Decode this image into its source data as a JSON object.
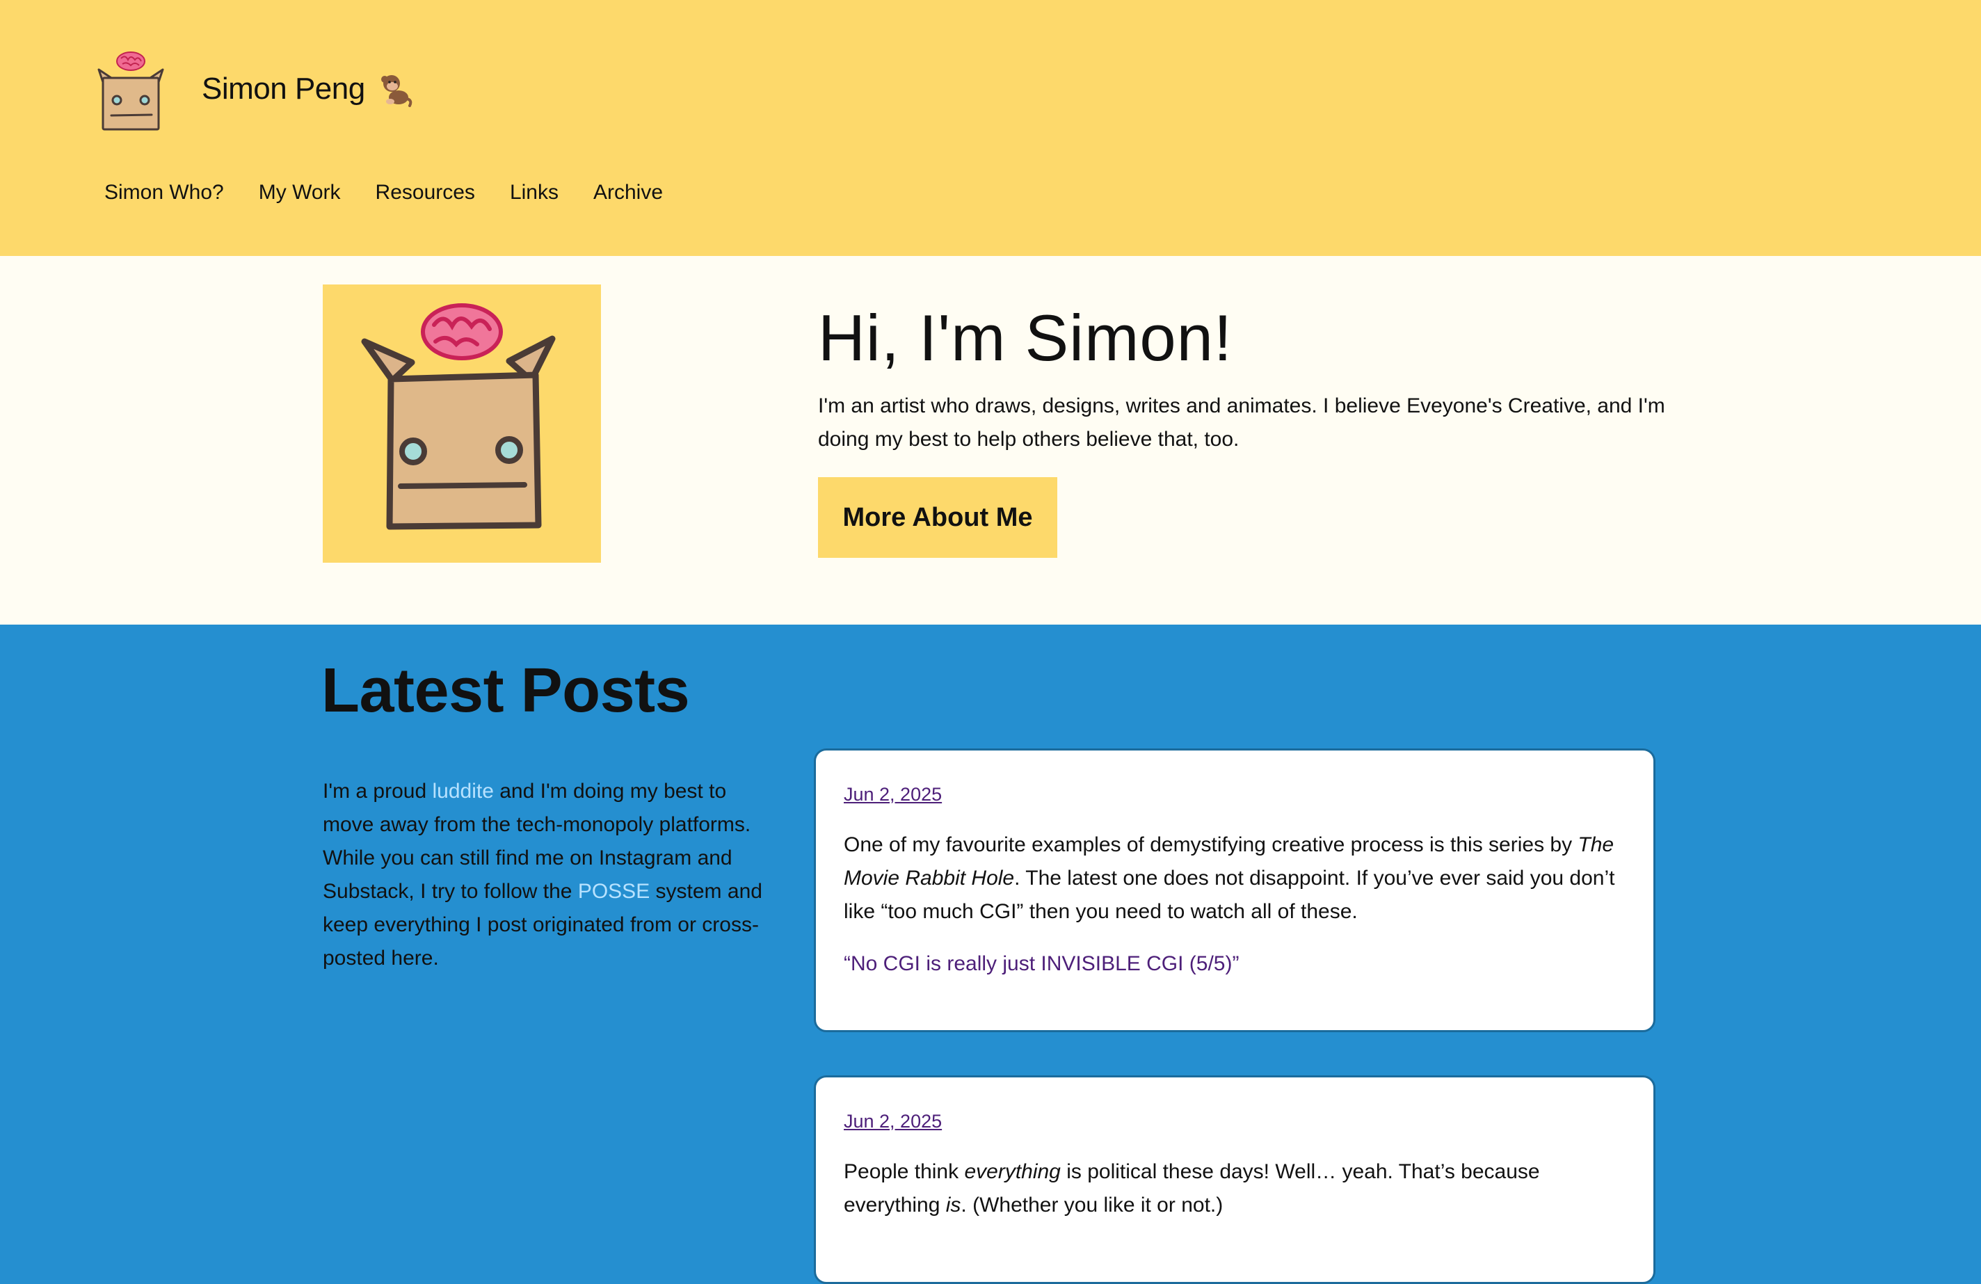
{
  "header": {
    "site_name": "Simon Peng",
    "site_emoji": "monkey-emoji-icon",
    "nav": [
      "Simon Who?",
      "My Work",
      "Resources",
      "Links",
      "Archive"
    ]
  },
  "hero": {
    "title": "Hi, I'm Simon!",
    "text": "I'm an artist who draws, designs, writes and animates. I believe Eveyone's Creative, and I'm doing my best to help others believe that, too.",
    "button": "More About Me"
  },
  "latest": {
    "heading": "Latest Posts",
    "intro_1": "I'm a proud ",
    "intro_link_1": "luddite",
    "intro_2": " and I'm doing my best to move away from the tech-monopoly platforms. While you can still find me on Instagram and Substack, I try to follow the ",
    "intro_link_2": "POSSE",
    "intro_3": " system and keep everything I post originated from or cross-posted here."
  },
  "posts": [
    {
      "date": "Jun 2, 2025",
      "body_1": "One of my favourite examples of demystifying creative process is this series by ",
      "body_em": "The Movie Rabbit Hole",
      "body_2": ". The latest one does not disappoint. If you’ve ever said you don’t like “too much CGI” then you need to watch all of these.",
      "link": "“No CGI is really just INVISIBLE CGI (5/5)”"
    },
    {
      "date": "Jun 2, 2025",
      "body_1": "People think ",
      "body_em": "everything",
      "body_2": " is political these days! Well… yeah. That’s because everything ",
      "body_em_2": "is",
      "body_3": ". (Whether you like it or not.)"
    }
  ],
  "colors": {
    "header_bg": "#fdd96b",
    "hero_bg": "#fffdf3",
    "posts_bg": "#258fd0",
    "link_light": "#b7e2ff",
    "date_purple": "#4d1f79"
  }
}
